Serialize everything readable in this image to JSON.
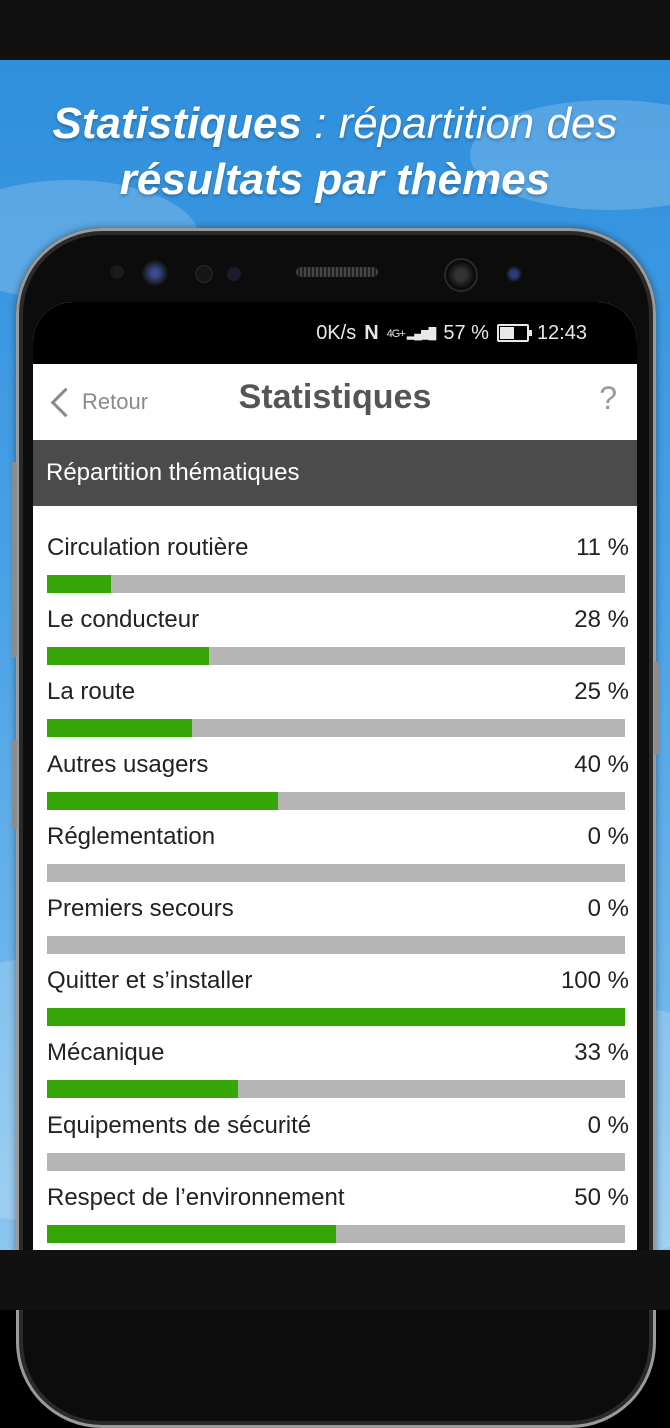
{
  "headline": {
    "part1_bold": "Statistiques",
    "part1_rest": " : répartition des",
    "part2": "résultats par thèmes"
  },
  "status_bar": {
    "speed": "0K/s",
    "nfc": "N",
    "network": "4G+",
    "battery": "57 %",
    "time": "12:43"
  },
  "nav": {
    "back_label": "Retour",
    "title": "Statistiques",
    "help": "?"
  },
  "section_title": "Répartition thématiques",
  "colors": {
    "accent": "#35a507",
    "track": "#b5b5b5",
    "header": "#4b4b4b"
  },
  "stats": [
    {
      "label": "Circulation routière",
      "percent_text": "11 %",
      "value": 11
    },
    {
      "label": "Le conducteur",
      "percent_text": "28 %",
      "value": 28
    },
    {
      "label": "La route",
      "percent_text": "25 %",
      "value": 25
    },
    {
      "label": "Autres usagers",
      "percent_text": "40 %",
      "value": 40
    },
    {
      "label": "Réglementation",
      "percent_text": "0 %",
      "value": 0
    },
    {
      "label": "Premiers secours",
      "percent_text": "0 %",
      "value": 0
    },
    {
      "label": "Quitter et s’installer",
      "percent_text": "100 %",
      "value": 100
    },
    {
      "label": "Mécanique",
      "percent_text": "33 %",
      "value": 33
    },
    {
      "label": "Equipements de sécurité",
      "percent_text": "0 %",
      "value": 0
    },
    {
      "label": "Respect de l’environnement",
      "percent_text": "50 %",
      "value": 50
    }
  ]
}
